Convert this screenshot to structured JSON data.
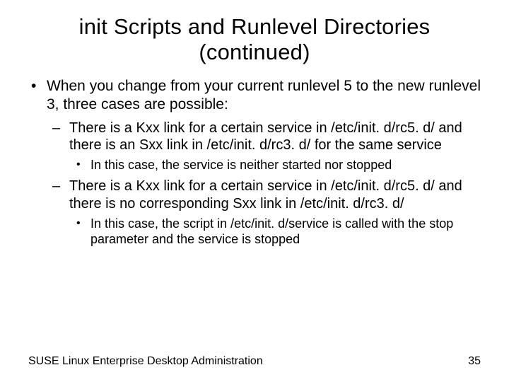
{
  "title_line1": "init Scripts and Runlevel Directories",
  "title_line2": "(continued)",
  "bullet1": "When you change from your current runlevel 5 to the new runlevel 3, three cases are possible:",
  "sub1": "There is a Kxx link for a certain service in /etc/init. d/rc5. d/ and there is an Sxx link in /etc/init. d/rc3. d/ for the same service",
  "sub1_detail": "In this case, the service is neither started nor stopped",
  "sub2": "There is a Kxx link for a certain service in /etc/init. d/rc5. d/ and there is no corresponding Sxx link in /etc/init. d/rc3. d/",
  "sub2_detail": "In this case, the script in /etc/init. d/service is called with the stop parameter and the service is stopped",
  "footer_left": "SUSE Linux Enterprise Desktop Administration",
  "footer_right": "35"
}
